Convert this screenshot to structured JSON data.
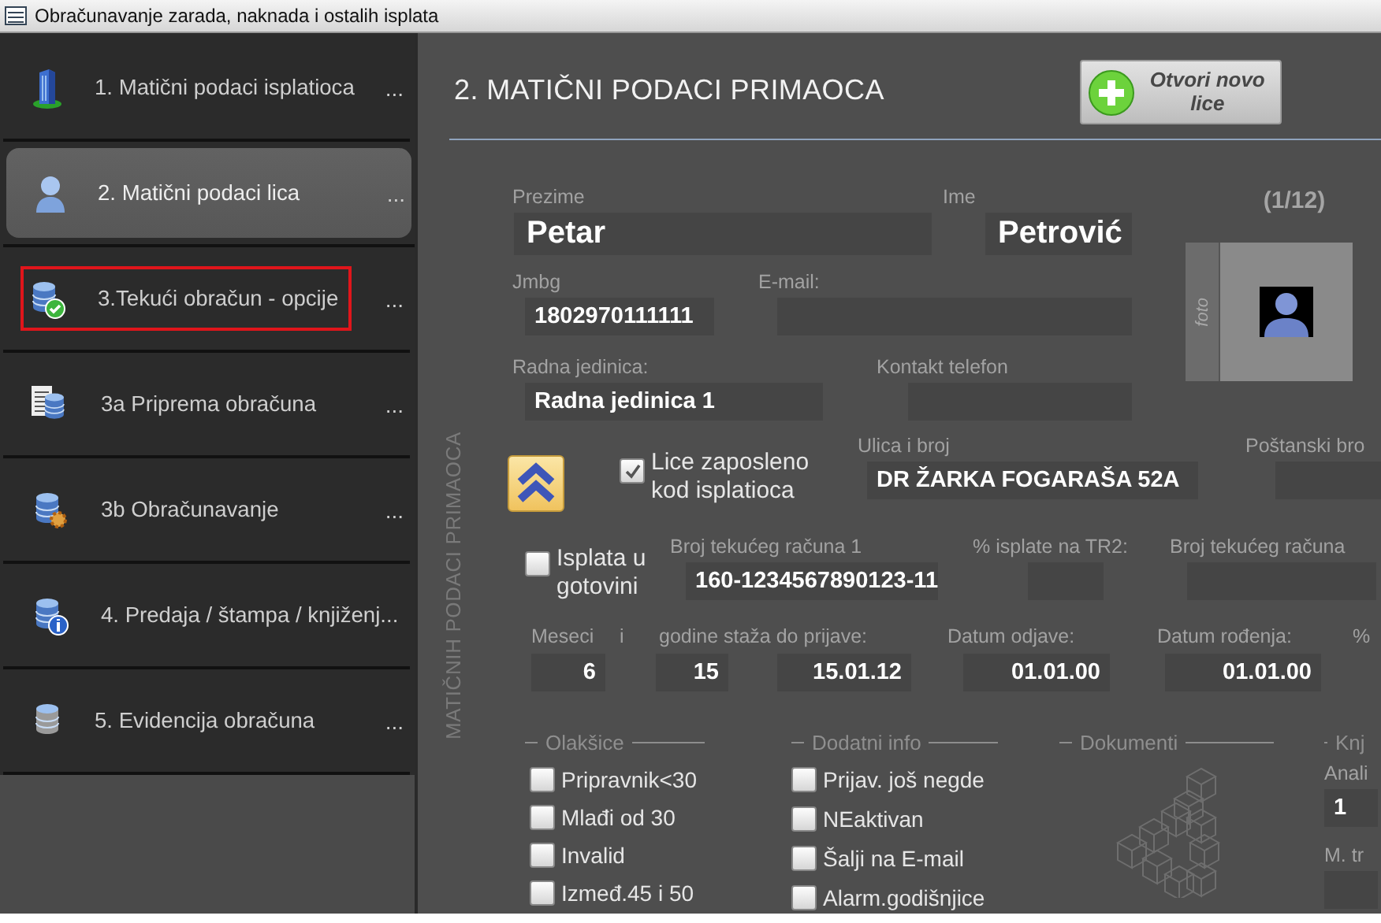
{
  "window": {
    "title": "Obračunavanje zarada, naknada i ostalih isplata"
  },
  "sidebar": {
    "items": [
      {
        "label": "1. Matični podaci isplatioca",
        "more": "...",
        "selected": false,
        "outlined": false
      },
      {
        "label": "2. Matični podaci lica",
        "more": "...",
        "selected": true,
        "outlined": false
      },
      {
        "label": "3.Tekući obračun - opcije",
        "more": "...",
        "selected": false,
        "outlined": true
      },
      {
        "label": "3a Priprema obračuna",
        "more": "...",
        "selected": false,
        "outlined": false
      },
      {
        "label": "3b Obračunavanje",
        "more": "...",
        "selected": false,
        "outlined": false
      },
      {
        "label": "4. Predaja / štampa / knjiženj...",
        "selected": false,
        "outlined": false
      },
      {
        "label": "5. Evidencija obračuna",
        "more": "...",
        "selected": false,
        "outlined": false
      }
    ]
  },
  "header": {
    "title": "2. MATIČNI PODACI PRIMAOCA",
    "new_button": "Otvori novo lice"
  },
  "side_label": "MATIČNIH PODACI PRIMAOCA",
  "record_counter": "(1/12)",
  "photo": {
    "label": "foto"
  },
  "fields": [
    {
      "label": "Prezime",
      "value": "Petar"
    },
    {
      "label": "Ime",
      "value": "Petrović"
    },
    {
      "label": "Jmbg",
      "value": "1802970111111"
    },
    {
      "label": "E-mail:"
    },
    {
      "label": "Radna jedinica:",
      "value": "Radna jedinica 1"
    },
    {
      "label": "Kontakt telefon"
    },
    {
      "label": "Ulica i broj",
      "value": "DR ŽARKA FOGARAŠA 52A"
    },
    {
      "label": "Poštanski bro"
    },
    {
      "label": "Broj tekućeg računa 1",
      "value": "160-1234567890123-11"
    },
    {
      "label": "% isplate na TR2:"
    },
    {
      "label": "Broj tekućeg računa"
    }
  ],
  "employed": {
    "label": "Lice zaposleno kod isplatioca",
    "checked": true
  },
  "cash": {
    "label": "Isplata u gotovini",
    "checked": false
  },
  "service_row": {
    "labels": [
      "Meseci",
      "i",
      "godine staža do prijave:",
      "Datum odjave:",
      "Datum rođenja:",
      "%"
    ],
    "values": [
      "6",
      "15",
      "15.01.12",
      "01.01.00",
      "01.01.00"
    ]
  },
  "groups": [
    {
      "title": "Olakšice",
      "kind": "checklist",
      "items": [
        {
          "label": "Pripravnik<30",
          "checked": false
        },
        {
          "label": "Mlađi od 30",
          "checked": false
        },
        {
          "label": "Invalid",
          "checked": false
        },
        {
          "label": "Izmeđ.45 i 50",
          "checked": false
        }
      ]
    },
    {
      "title": "Dodatni info",
      "kind": "checklist",
      "items": [
        {
          "label": "Prijav. još negde",
          "checked": false
        },
        {
          "label": "NEaktivan",
          "checked": false
        },
        {
          "label": "Šalji na E-mail",
          "checked": false
        },
        {
          "label": "Alarm.godišnjice",
          "checked": false
        }
      ]
    },
    {
      "title": "Dokumenti",
      "kind": "drawing"
    },
    {
      "title": "Knj",
      "kind": "fields",
      "fields": [
        {
          "label": "Anali",
          "value": "1"
        },
        {
          "label": "M. tr"
        }
      ]
    }
  ]
}
